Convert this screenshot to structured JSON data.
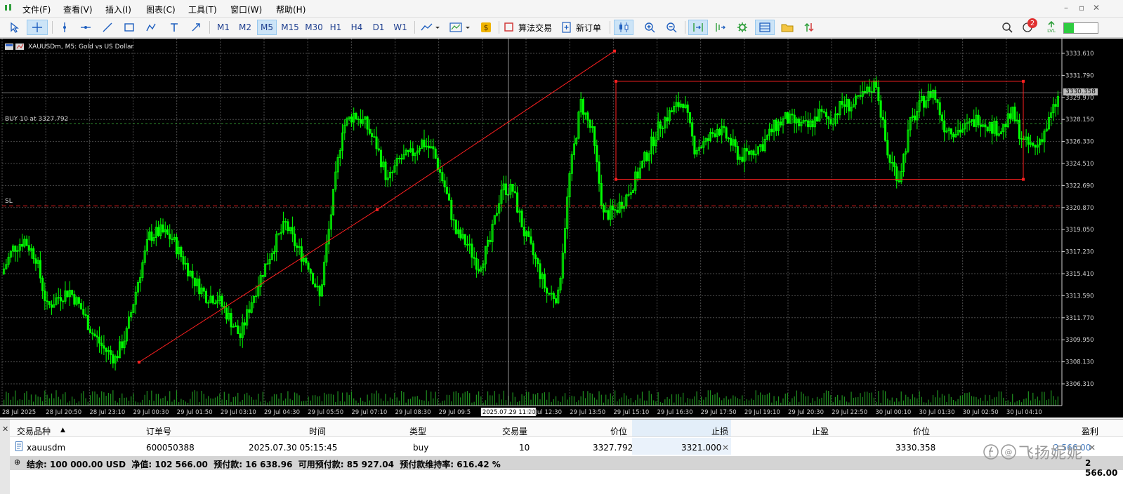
{
  "menu": [
    "文件(F)",
    "查看(V)",
    "插入(I)",
    "图表(C)",
    "工具(T)",
    "窗口(W)",
    "帮助(H)"
  ],
  "toolbar": {
    "timeframes": [
      "M1",
      "M2",
      "M5",
      "M15",
      "M30",
      "H1",
      "H4",
      "D1",
      "W1"
    ],
    "active_timeframe": "M5",
    "algo_label": "算法交易",
    "new_order_label": "新订单",
    "notification_count": "2",
    "lvl_label": "LVL"
  },
  "chart": {
    "title": "XAUUSDm, M5:  Gold vs US Dollar",
    "buy_line_label": "BUY 10 at 3327.792",
    "sl_label": "SL",
    "current_price": "3330.358",
    "price_ticks": [
      "3333.610",
      "3331.790",
      "3329.970",
      "3328.150",
      "3326.330",
      "3324.510",
      "3322.690",
      "3320.870",
      "3319.050",
      "3317.230",
      "3315.410",
      "3313.590",
      "3311.770",
      "3309.950",
      "3308.130",
      "3306.310"
    ],
    "time_labels": [
      "28 Jul 2025",
      "28 Jul 20:50",
      "28 Jul 23:10",
      "29 Jul 00:30",
      "29 Jul 01:50",
      "29 Jul 03:10",
      "29 Jul 04:30",
      "29 Jul 05:50",
      "29 Jul 07:10",
      "29 Jul 08:30",
      "29 Jul 09:5",
      "2025.07.29 11:20",
      "29 Jul 12:30",
      "29 Jul 13:50",
      "29 Jul 15:10",
      "29 Jul 16:30",
      "29 Jul 17:50",
      "29 Jul 19:10",
      "29 Jul 20:30",
      "29 Jul 22:50",
      "30 Jul 00:10",
      "30 Jul 01:30",
      "30 Jul 02:50",
      "30 Jul 04:10"
    ]
  },
  "chart_data": {
    "type": "candlestick",
    "title": "XAUUSDm, M5:  Gold vs US Dollar",
    "ylim": [
      3304.5,
      3335.0
    ],
    "grid": true,
    "closes": [
      3315.4,
      3317.5,
      3318.2,
      3316.8,
      3312.6,
      3313.5,
      3314.0,
      3312.5,
      3310.5,
      3309.2,
      3308.4,
      3310.5,
      3314.8,
      3318.5,
      3318.9,
      3318.3,
      3316.5,
      3314.8,
      3313.6,
      3313.4,
      3311.8,
      3310.2,
      3313.2,
      3315.6,
      3317.8,
      3319.5,
      3317.5,
      3316.2,
      3313.4,
      3320.4,
      3327.5,
      3328.6,
      3327.8,
      3326.0,
      3323.0,
      3324.8,
      3325.2,
      3326.3,
      3325.5,
      3322.6,
      3318.8,
      3317.8,
      3316.0,
      3318.0,
      3322.5,
      3322.3,
      3318.8,
      3316.5,
      3313.8,
      3313.5,
      3323.5,
      3329.5,
      3327.0,
      3320.2,
      3320.6,
      3321.8,
      3323.6,
      3325.7,
      3327.8,
      3328.8,
      3329.7,
      3325.8,
      3326.2,
      3327.5,
      3326.5,
      3325.0,
      3325.5,
      3326.1,
      3327.5,
      3328.2,
      3327.8,
      3327.5,
      3328.6,
      3328.1,
      3329.4,
      3329.3,
      3330.2,
      3331.2,
      3325.2,
      3323.3,
      3327.8,
      3329.5,
      3330.5,
      3327.6,
      3327.2,
      3327.5,
      3328.3,
      3327.6,
      3327.3,
      3328.6,
      3326.2,
      3325.8,
      3327.5,
      3329.9
    ],
    "open_order": {
      "type": "buy",
      "volume": 10,
      "price": 3327.792,
      "stop_loss": 3321.0
    },
    "current_price": 3330.358
  },
  "table": {
    "headers": {
      "symbol": "交易品种",
      "order": "订单号",
      "time": "时间",
      "type": "类型",
      "volume": "交易量",
      "price": "价位",
      "sl": "止损",
      "tp": "止盈",
      "cur_price": "价位",
      "profit": "盈利"
    },
    "rows": [
      {
        "symbol": "xauusdm",
        "order": "600050388",
        "time": "2025.07.30 05:15:45",
        "type": "buy",
        "volume": "10",
        "price": "3327.792",
        "sl": "3321.000",
        "tp": "",
        "cur_price": "3330.358",
        "profit": "2 566.00"
      }
    ],
    "summary": "结余: 100 000.00 USD  净值: 102 566.00  预付款: 16 638.96  可用预付款: 85 927.04  预付款维持率: 616.42 %",
    "summary_profit": "2 566.00",
    "watermark": "飞扬妮妮"
  },
  "colors": {
    "candle": "#00ff00",
    "grid": "#4a4a4a",
    "axis_text": "#cfcfcf",
    "annotation": "#ff2020",
    "buy_line": "#2e8b2e",
    "sl_line": "#ff2020",
    "bg": "#000000"
  }
}
